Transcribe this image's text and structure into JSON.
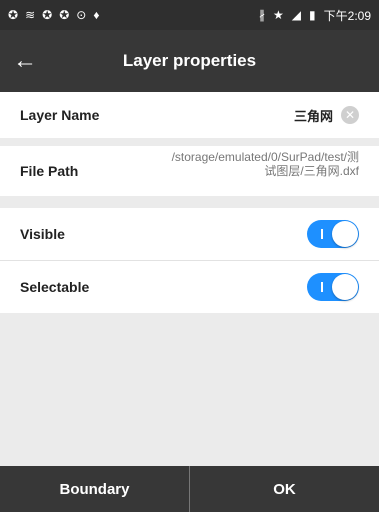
{
  "status_bar": {
    "icons": [
      "notification-icon",
      "wifi-icon",
      "sync-icon",
      "sync-icon",
      "alarm-icon",
      "location-icon",
      "bluetooth-icon",
      "star-icon",
      "signal-icon",
      "battery-icon"
    ],
    "time": "下午2:09"
  },
  "header": {
    "title": "Layer properties",
    "back_icon": "arrow-left-icon"
  },
  "layer_name": {
    "label": "Layer Name",
    "value": "三角网"
  },
  "file_path": {
    "label": "File Path",
    "value": "/storage/emulated/0/SurPad/test/测试图层/三角网.dxf"
  },
  "visible": {
    "label": "Visible",
    "on": true
  },
  "selectable": {
    "label": "Selectable",
    "on": true
  },
  "footer": {
    "boundary_label": "Boundary",
    "ok_label": "OK"
  },
  "colors": {
    "toggle_on": "#1e90ff",
    "bar_background": "#373737"
  }
}
